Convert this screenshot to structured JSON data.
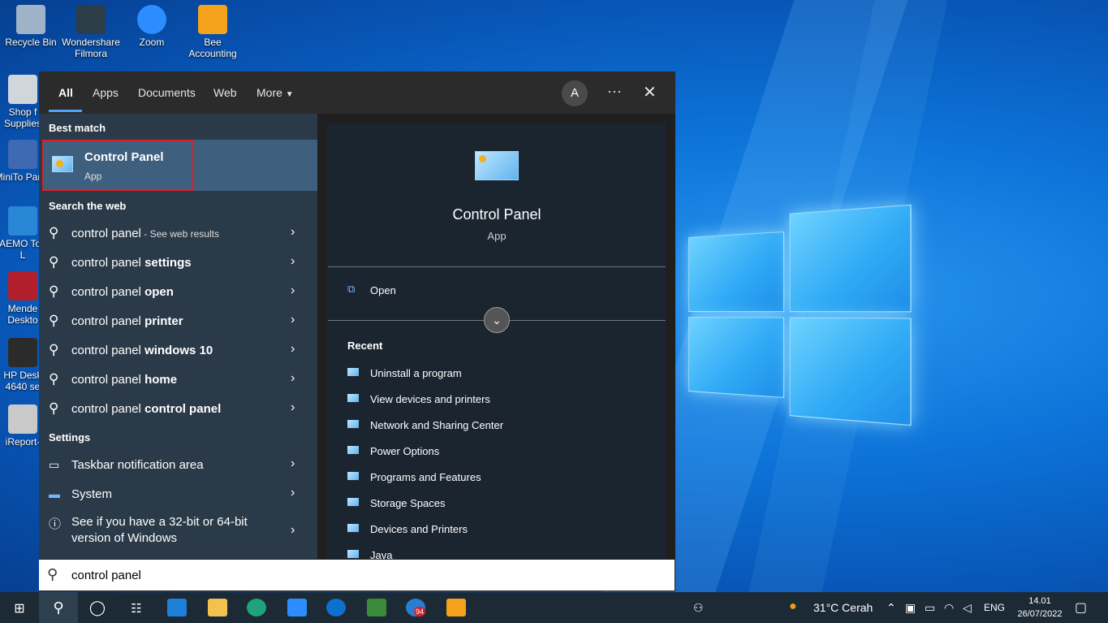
{
  "desktop": {
    "icons": [
      {
        "label": "Recycle Bin",
        "color": "#9fb3c8"
      },
      {
        "label": "Wondershare Filmora",
        "color": "#2d3d48"
      },
      {
        "label": "Zoom",
        "color": "#2d8cff"
      },
      {
        "label": "Bee Accounting",
        "color": "#f4a21b"
      },
      {
        "label": "Shop f Supplies",
        "color": "#cfd6dc"
      },
      {
        "label": "MiniTo Partiti",
        "color": "#3d6ab3"
      },
      {
        "label": "DAEMO Tools L",
        "color": "#2a86d6"
      },
      {
        "label": "Mende Deskto",
        "color": "#b11f2d"
      },
      {
        "label": "HP Desk 4640 se",
        "color": "#2b2b2b"
      },
      {
        "label": "iReport-",
        "color": "#c9c9c9"
      }
    ]
  },
  "search_panel": {
    "tabs": [
      "All",
      "Apps",
      "Documents",
      "Web",
      "More"
    ],
    "avatar_letter": "A",
    "more_icon": "ellipsis-icon",
    "close_icon": "close-icon",
    "best_match_heading": "Best match",
    "best_match": {
      "title": "Control Panel",
      "subtitle": "App"
    },
    "search_web_heading": "Search the web",
    "web_results": [
      {
        "prefix": "control panel",
        "bold": "",
        "suffix": " - See web results"
      },
      {
        "prefix": "control panel ",
        "bold": "settings",
        "suffix": ""
      },
      {
        "prefix": "control panel ",
        "bold": "open",
        "suffix": ""
      },
      {
        "prefix": "control panel ",
        "bold": "printer",
        "suffix": ""
      },
      {
        "prefix": "control panel ",
        "bold": "windows 10",
        "suffix": ""
      },
      {
        "prefix": "control panel ",
        "bold": "home",
        "suffix": ""
      },
      {
        "prefix": "control panel ",
        "bold": "control panel",
        "suffix": ""
      }
    ],
    "settings_heading": "Settings",
    "settings_results": [
      {
        "label": "Taskbar notification area",
        "icon": "taskbar-icon"
      },
      {
        "label": "System",
        "icon": "monitor-icon"
      },
      {
        "label": "See if you have a 32-bit or 64-bit",
        "label2": "version of Windows",
        "icon": "info-icon"
      }
    ],
    "detail": {
      "title": "Control Panel",
      "subtitle": "App",
      "open_label": "Open",
      "recent_heading": "Recent",
      "recent": [
        "Uninstall a program",
        "View devices and printers",
        "Network and Sharing Center",
        "Power Options",
        "Programs and Features",
        "Storage Spaces",
        "Devices and Printers",
        "Java"
      ]
    },
    "search_value": "control panel"
  },
  "taskbar": {
    "weather": "31°C  Cerah",
    "language": "ENG",
    "time": "14.01",
    "date": "26/07/2022",
    "badge": "94"
  },
  "colors": {
    "accent": "#4fa3ff",
    "highlight_outline": "#e01e25",
    "best_match_bg": "#3e5f7e"
  }
}
